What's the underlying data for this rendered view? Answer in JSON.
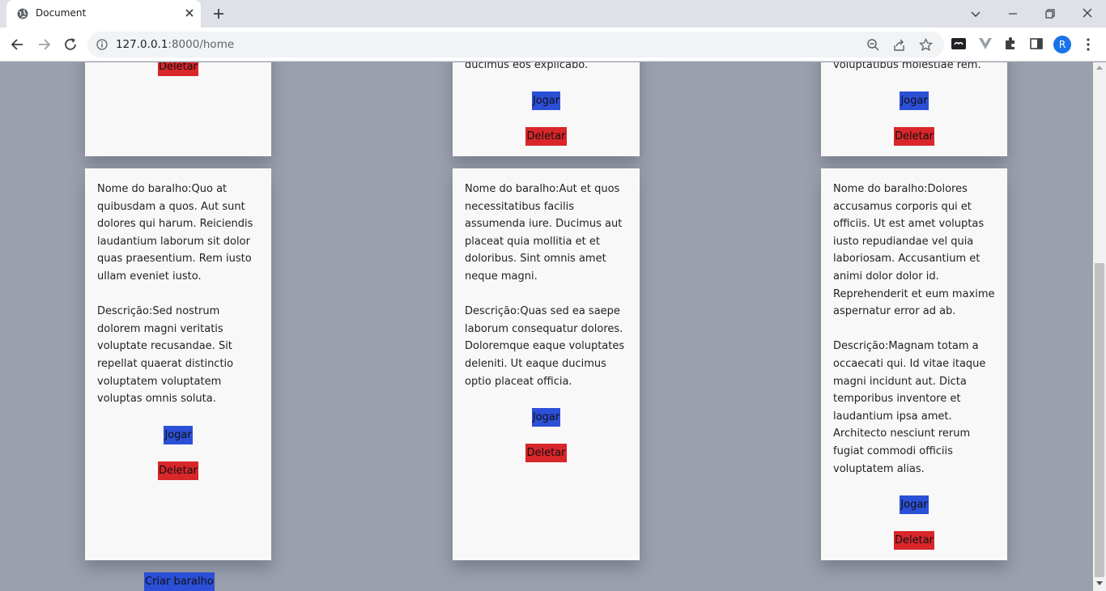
{
  "browser": {
    "tab_title": "Document",
    "url_host": "127.0.0.1",
    "url_path": ":8000/home",
    "profile_initial": "R"
  },
  "top_fragments": {
    "col2_last_line": "ducimus eos explicabo.",
    "col3_last_line": "voluptatibus molestiae rem."
  },
  "cards": [
    {
      "name": "Nome do baralho:Quo at quibusdam a quos. Aut sunt dolores qui harum. Reiciendis laudantium laborum sit dolor quas praesentium. Rem iusto ullam eveniet iusto.",
      "description": "Descrição:Sed nostrum dolorem magni veritatis voluptate recusandae. Sit repellat quaerat distinctio voluptatem voluptatem voluptas omnis soluta."
    },
    {
      "name": "Nome do baralho:Aut et quos necessitatibus facilis assumenda iure. Ducimus aut placeat quia mollitia et et doloribus. Sint omnis amet neque magni.",
      "description": "Descrição:Quas sed ea saepe laborum consequatur dolores. Doloremque eaque voluptates deleniti. Ut eaque ducimus optio placeat officia."
    },
    {
      "name": "Nome do baralho:Dolores accusamus corporis qui et officiis. Ut est amet voluptas iusto repudiandae vel quia laboriosam. Accusantium et animi dolor dolor id. Reprehenderit et eum maxime aspernatur error ad ab.",
      "description": "Descrição:Magnam totam a occaecati qui. Id vitae itaque magni incidunt aut. Dicta temporibus inventore et laudantium ipsa amet. Architecto nesciunt rerum fugiat commodi officiis voluptatem alias."
    }
  ],
  "buttons": {
    "play": "Jogar",
    "delete": "Deletar",
    "create": "Criar baralho"
  },
  "colors": {
    "page_bg": "#9aa0ad",
    "card_bg": "#f8f8f8",
    "play_button": "#2b4fd6",
    "delete_button": "#d8262b"
  }
}
